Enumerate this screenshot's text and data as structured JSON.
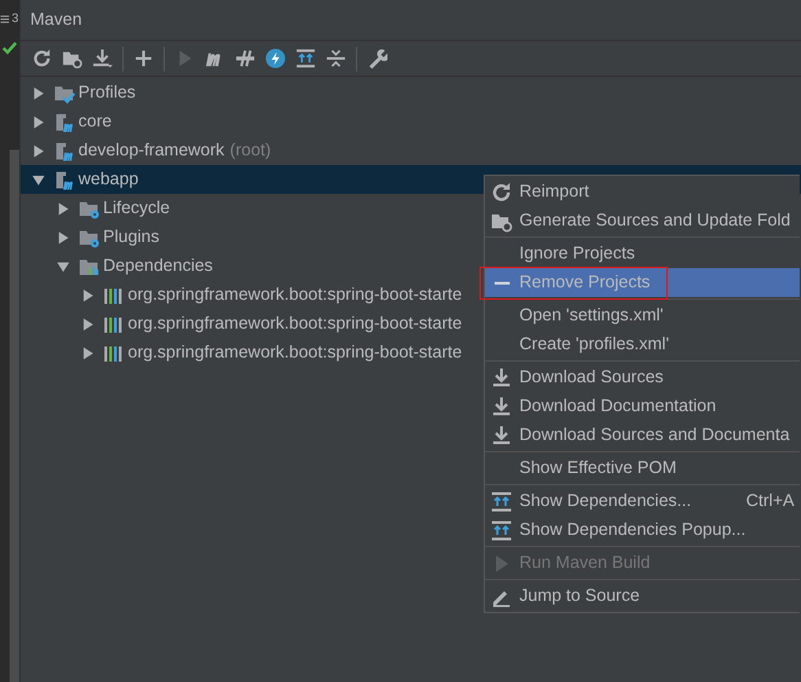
{
  "side_strip": {
    "label": "3",
    "checked": true
  },
  "panel": {
    "title": "Maven"
  },
  "tree": [
    {
      "label": "Profiles",
      "kind": "profiles",
      "expanded": false,
      "selected": false
    },
    {
      "label": "core",
      "kind": "module",
      "expanded": false,
      "selected": false
    },
    {
      "label": "develop-framework",
      "suffix": "(root)",
      "kind": "module",
      "expanded": false,
      "selected": false
    },
    {
      "label": "webapp",
      "kind": "module",
      "expanded": true,
      "selected": true,
      "children": [
        {
          "label": "Lifecycle",
          "kind": "folder",
          "expanded": false,
          "selected": false
        },
        {
          "label": "Plugins",
          "kind": "folder",
          "expanded": false,
          "selected": false
        },
        {
          "label": "Dependencies",
          "kind": "dependencies",
          "expanded": true,
          "selected": false,
          "children": [
            {
              "label": "org.springframework.boot:spring-boot-starte",
              "kind": "library",
              "expanded": false,
              "selected": false
            },
            {
              "label": "org.springframework.boot:spring-boot-starte",
              "kind": "library",
              "expanded": false,
              "selected": false
            },
            {
              "label": "org.springframework.boot:spring-boot-starte",
              "kind": "library",
              "expanded": false,
              "selected": false
            }
          ]
        }
      ]
    }
  ],
  "menu": {
    "groups": [
      [
        {
          "label": "Reimport",
          "selected": false,
          "disabled": false
        },
        {
          "label": "Generate Sources and Update Fold",
          "selected": false,
          "disabled": false
        }
      ],
      [
        {
          "label": "Ignore Projects",
          "selected": false,
          "disabled": false
        },
        {
          "label": "Remove Projects",
          "selected": true,
          "disabled": false,
          "annotated": true
        }
      ],
      [
        {
          "label": "Open 'settings.xml'",
          "selected": false,
          "disabled": false
        },
        {
          "label": "Create 'profiles.xml'",
          "selected": false,
          "disabled": false
        }
      ],
      [
        {
          "label": "Download Sources",
          "selected": false,
          "disabled": false
        },
        {
          "label": "Download Documentation",
          "selected": false,
          "disabled": false
        },
        {
          "label": "Download Sources and Documenta",
          "selected": false,
          "disabled": false
        }
      ],
      [
        {
          "label": "Show Effective POM",
          "selected": false,
          "disabled": false
        }
      ],
      [
        {
          "label": "Show Dependencies...",
          "shortcut": "Ctrl+A",
          "selected": false,
          "disabled": false
        },
        {
          "label": "Show Dependencies Popup...",
          "selected": false,
          "disabled": false
        }
      ],
      [
        {
          "label": "Run Maven Build",
          "selected": false,
          "disabled": true
        }
      ],
      [
        {
          "label": "Jump to Source",
          "selected": false,
          "disabled": false
        }
      ]
    ]
  }
}
